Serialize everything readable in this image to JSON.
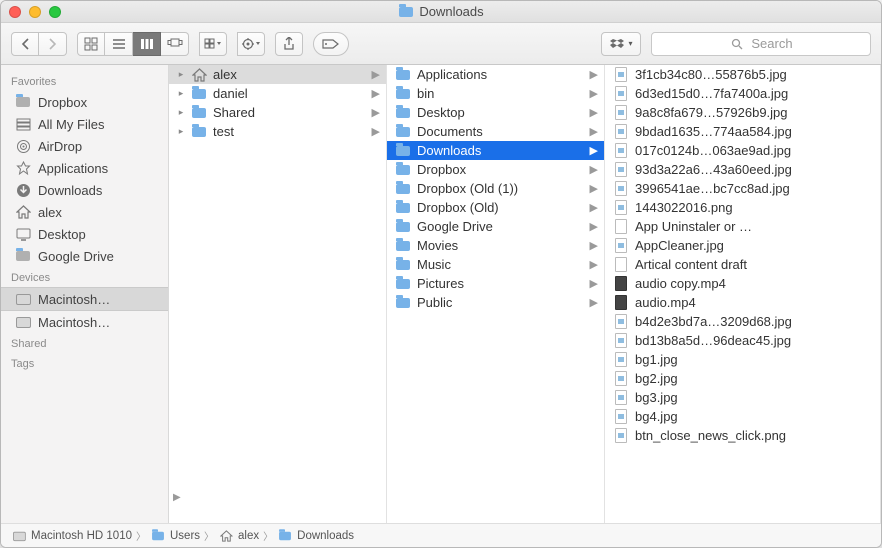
{
  "title": "Downloads",
  "search_placeholder": "Search",
  "sidebar": {
    "sections": [
      {
        "label": "Favorites",
        "items": [
          {
            "label": "Dropbox",
            "icon": "folder-grey"
          },
          {
            "label": "All My Files",
            "icon": "stack"
          },
          {
            "label": "AirDrop",
            "icon": "airdrop"
          },
          {
            "label": "Applications",
            "icon": "apps"
          },
          {
            "label": "Downloads",
            "icon": "download"
          },
          {
            "label": "alex",
            "icon": "home"
          },
          {
            "label": "Desktop",
            "icon": "desktop"
          },
          {
            "label": "Google Drive",
            "icon": "folder-grey"
          }
        ]
      },
      {
        "label": "Devices",
        "items": [
          {
            "label": "Macintosh…",
            "icon": "hd",
            "selected": true
          },
          {
            "label": "Macintosh…",
            "icon": "hd"
          }
        ]
      },
      {
        "label": "Shared",
        "items": []
      },
      {
        "label": "Tags",
        "items": []
      }
    ]
  },
  "col1": [
    {
      "label": "alex",
      "icon": "home",
      "expand": true,
      "selected": true
    },
    {
      "label": "daniel",
      "icon": "folder",
      "expand": true
    },
    {
      "label": "Shared",
      "icon": "folder",
      "expand": true
    },
    {
      "label": "test",
      "icon": "folder",
      "expand": true
    }
  ],
  "col2": [
    {
      "label": "Applications",
      "icon": "folder",
      "expand": true
    },
    {
      "label": "bin",
      "icon": "folder",
      "expand": true
    },
    {
      "label": "Desktop",
      "icon": "folder",
      "expand": true
    },
    {
      "label": "Documents",
      "icon": "folder",
      "expand": true
    },
    {
      "label": "Downloads",
      "icon": "folder",
      "expand": true,
      "selected": true
    },
    {
      "label": "Dropbox",
      "icon": "folder",
      "expand": true
    },
    {
      "label": "Dropbox (Old (1))",
      "icon": "folder",
      "expand": true
    },
    {
      "label": "Dropbox (Old)",
      "icon": "folder",
      "expand": true
    },
    {
      "label": "Google Drive",
      "icon": "folder",
      "expand": true
    },
    {
      "label": "Movies",
      "icon": "folder",
      "expand": true
    },
    {
      "label": "Music",
      "icon": "folder",
      "expand": true
    },
    {
      "label": "Pictures",
      "icon": "folder",
      "expand": true
    },
    {
      "label": "Public",
      "icon": "folder",
      "expand": true
    }
  ],
  "col3": [
    {
      "label": "3f1cb34c80…55876b5.jpg",
      "icon": "img"
    },
    {
      "label": "6d3ed15d0…7fa7400a.jpg",
      "icon": "img"
    },
    {
      "label": "9a8c8fa679…57926b9.jpg",
      "icon": "img"
    },
    {
      "label": "9bdad1635…774aa584.jpg",
      "icon": "img"
    },
    {
      "label": "017c0124b…063ae9ad.jpg",
      "icon": "img"
    },
    {
      "label": "93d3a22a6…43a60eed.jpg",
      "icon": "img"
    },
    {
      "label": "3996541ae…bc7cc8ad.jpg",
      "icon": "img"
    },
    {
      "label": "1443022016.png",
      "icon": "img"
    },
    {
      "label": "App Uninstaler or …",
      "icon": "doc"
    },
    {
      "label": "AppCleaner.jpg",
      "icon": "img"
    },
    {
      "label": "Artical content draft",
      "icon": "doc"
    },
    {
      "label": "audio copy.mp4",
      "icon": "mov"
    },
    {
      "label": "audio.mp4",
      "icon": "mov"
    },
    {
      "label": "b4d2e3bd7a…3209d68.jpg",
      "icon": "img"
    },
    {
      "label": "bd13b8a5d…96deac45.jpg",
      "icon": "img"
    },
    {
      "label": "bg1.jpg",
      "icon": "img"
    },
    {
      "label": "bg2.jpg",
      "icon": "img"
    },
    {
      "label": "bg3.jpg",
      "icon": "img"
    },
    {
      "label": "bg4.jpg",
      "icon": "img"
    },
    {
      "label": "btn_close_news_click.png",
      "icon": "img"
    }
  ],
  "path": [
    {
      "label": "Macintosh HD 1010",
      "icon": "hd"
    },
    {
      "label": "Users",
      "icon": "folder"
    },
    {
      "label": "alex",
      "icon": "home"
    },
    {
      "label": "Downloads",
      "icon": "folder"
    }
  ]
}
